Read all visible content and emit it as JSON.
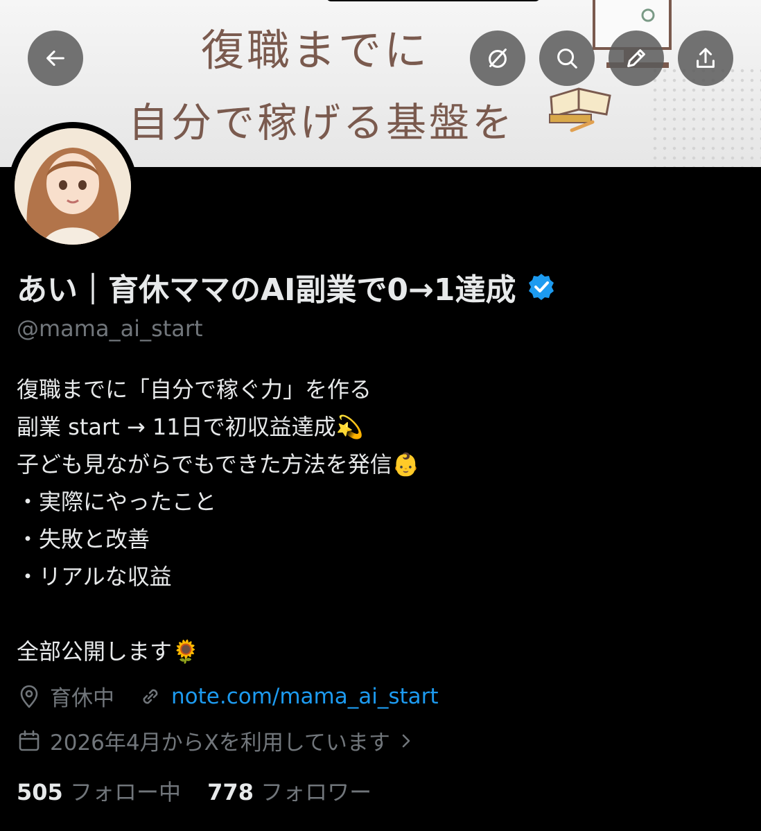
{
  "banner": {
    "line1": "復職までに",
    "line2": "自分で稼げる基盤を"
  },
  "header": {
    "back_icon": "arrow-left-icon",
    "toggle_icon": "circle-slash-icon",
    "search_icon": "search-icon",
    "edit_icon": "pencil-icon",
    "share_icon": "share-icon"
  },
  "profile": {
    "name": "あい｜育休ママのAI副業で0→1達成",
    "handle": "@mama_ai_start",
    "verified_color": "#1d9bf0",
    "bio_lines": [
      "復職までに「自分で稼ぐ力」を作る",
      "副業 start → 11日で初収益達成💫",
      "子ども見ながらでもできた方法を発信👶",
      "・実際にやったこと",
      "・失敗と改善",
      "・リアルな収益",
      "",
      "全部公開します🌻"
    ],
    "location": "育休中",
    "url": "note.com/mama_ai_start",
    "joined": "2026年4月からXを利用しています",
    "following_count": "505",
    "following_label": "フォロー中",
    "followers_count": "778",
    "followers_label": "フォロワー"
  },
  "colors": {
    "background": "#000000",
    "text": "#e7e9ea",
    "muted": "#71767b",
    "link": "#1d9bf0",
    "banner_text": "#7a5a4e"
  }
}
